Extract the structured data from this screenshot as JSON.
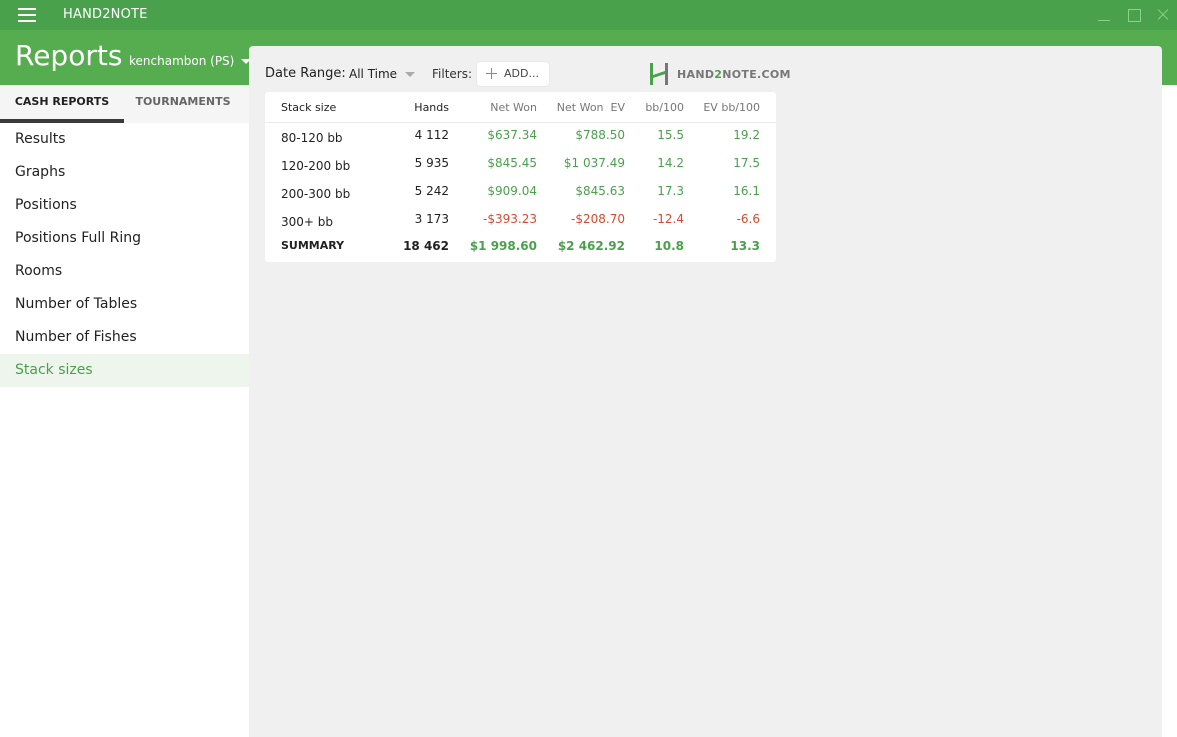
{
  "app": {
    "title": "HAND2NOTE"
  },
  "header": {
    "title": "Reports",
    "account": "kenchambon (PS)"
  },
  "tabs": [
    {
      "label": "CASH REPORTS"
    },
    {
      "label": "TOURNAMENTS"
    }
  ],
  "sidebar": {
    "items": [
      {
        "label": "Results"
      },
      {
        "label": "Graphs"
      },
      {
        "label": "Positions"
      },
      {
        "label": "Positions Full Ring"
      },
      {
        "label": "Rooms"
      },
      {
        "label": "Number of Tables"
      },
      {
        "label": "Number of Fishes"
      },
      {
        "label": "Stack sizes"
      }
    ],
    "active": "Stack sizes"
  },
  "toolbar": {
    "date_range_label": "Date Range:",
    "date_range_value": "All Time",
    "filters_label": "Filters:",
    "add_label": "ADD..."
  },
  "logo": {
    "text_a": "HAND",
    "text_b": "2",
    "text_c": "NOTE.COM"
  },
  "table": {
    "headers": {
      "stack": "Stack size",
      "hands": "Hands",
      "net": "Net Won",
      "ev": "Net Won  EV",
      "bb": "bb/100",
      "evbb": "EV bb/100"
    },
    "rows": [
      {
        "stack": "80-120 bb",
        "hands": "4 112",
        "net": "$637.34",
        "ev": "$788.50",
        "bb": "15.5",
        "evbb": "19.2"
      },
      {
        "stack": "120-200 bb",
        "hands": "5 935",
        "net": "$845.45",
        "ev": "$1 037.49",
        "bb": "14.2",
        "evbb": "17.5"
      },
      {
        "stack": "200-300 bb",
        "hands": "5 242",
        "net": "$909.04",
        "ev": "$845.63",
        "bb": "17.3",
        "evbb": "16.1"
      },
      {
        "stack": "300+ bb",
        "hands": "3 173",
        "net": "-$393.23",
        "ev": "-$208.70",
        "bb": "-12.4",
        "evbb": "-6.6"
      }
    ],
    "summary": {
      "stack": "SUMMARY",
      "hands": "18 462",
      "net": "$1 998.60",
      "ev": "$2 462.92",
      "bb": "10.8",
      "evbb": "13.3"
    }
  },
  "colors": {
    "accent": "#4aa14c",
    "header": "#56ad50",
    "negative": "#d84a2a"
  }
}
